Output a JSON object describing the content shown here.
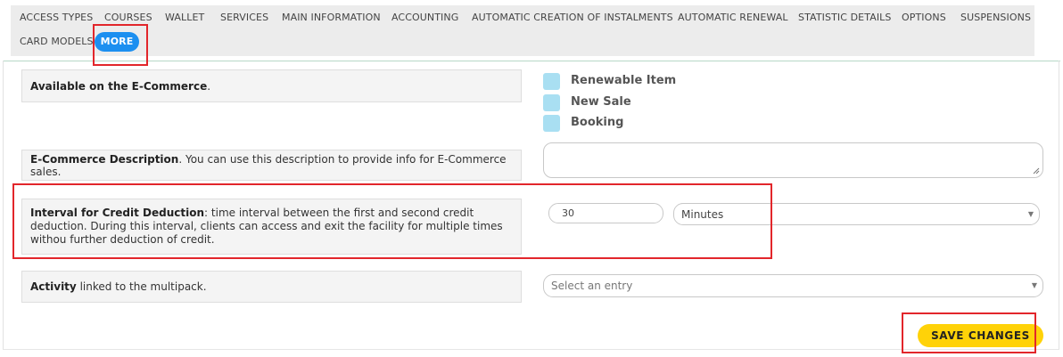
{
  "tabs": [
    {
      "label": "ACCESS TYPES"
    },
    {
      "label": "COURSES"
    },
    {
      "label": "WALLET"
    },
    {
      "label": "SERVICES"
    },
    {
      "label": "MAIN INFORMATION"
    },
    {
      "label": "ACCOUNTING"
    },
    {
      "label": "AUTOMATIC CREATION OF INSTALMENTS"
    },
    {
      "label": "AUTOMATIC RENEWAL"
    },
    {
      "label": "STATISTIC DETAILS"
    },
    {
      "label": "OPTIONS"
    },
    {
      "label": "SUSPENSIONS"
    },
    {
      "label": "CARD MODELS"
    },
    {
      "label": "MORE",
      "active": true
    }
  ],
  "ecommerce": {
    "label_bold": "Available on the E-Commerce",
    "label_rest": ".",
    "options": [
      {
        "label": "Renewable Item",
        "checked": false
      },
      {
        "label": "New Sale",
        "checked": false
      },
      {
        "label": "Booking",
        "checked": false
      }
    ]
  },
  "description": {
    "label_bold": "E-Commerce Description",
    "label_rest": ". You can use this description to provide info for E-Commerce sales.",
    "value": ""
  },
  "interval": {
    "label_bold": "Interval for Credit Deduction",
    "label_rest": ": time interval between the first and second credit deduction. During this interval, clients can access and exit the facility for multiple times withou further deduction of credit.",
    "value": "30",
    "unit": "Minutes"
  },
  "activity": {
    "label_bold": "Activity",
    "label_rest": " linked to the multipack.",
    "placeholder": "Select an entry"
  },
  "save_label": "SAVE CHANGES",
  "colors": {
    "accent": "#1c8ff0",
    "save": "#ffd208",
    "checkbox": "#a9dff2",
    "highlight": "#e2262b"
  }
}
